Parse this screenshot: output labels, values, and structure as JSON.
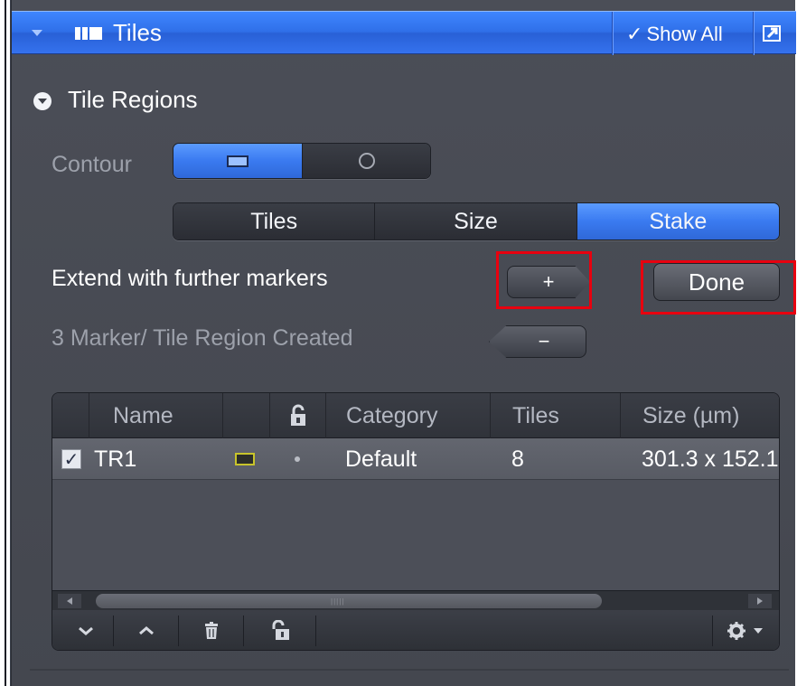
{
  "panel": {
    "title": "Tiles",
    "show_all_label": "Show All",
    "show_all_check": "✓"
  },
  "tile_regions": {
    "section_title": "Tile Regions",
    "contour_label": "Contour",
    "contour_options": [
      "rectangle",
      "circle"
    ],
    "contour_selected": "rectangle",
    "mode_tabs": [
      "Tiles",
      "Size",
      "Stake"
    ],
    "mode_selected": "Stake",
    "extend_label": "Extend with further markers",
    "add_marker_label": "+",
    "remove_marker_label": "−",
    "done_label": "Done",
    "status_text": "3 Marker/ Tile Region Created"
  },
  "table": {
    "columns": [
      "",
      "Name",
      "",
      "",
      "Category",
      "Tiles",
      "Size (µm)"
    ],
    "rows": [
      {
        "checked": true,
        "check_mark": "✓",
        "name": "TR1",
        "category": "Default",
        "tiles": "8",
        "size": "301.3 x 152.1"
      }
    ],
    "toolbar": [
      "move-down",
      "move-up",
      "delete",
      "unlock",
      "settings"
    ]
  },
  "colors": {
    "header_blue": "#2f6fe8",
    "panel_bg": "#4b4e57",
    "highlight_red": "#e8000f",
    "region_yellow": "#c8c42b"
  }
}
